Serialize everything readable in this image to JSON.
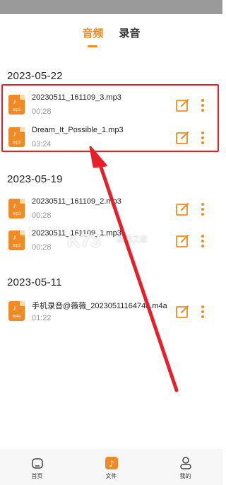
{
  "tabs": [
    {
      "label": "音频",
      "active": true
    },
    {
      "label": "录音",
      "active": false
    }
  ],
  "groups": [
    {
      "date": "2023-05-22",
      "items": [
        {
          "name": "20230511_161109_3.mp3",
          "duration": "00:28",
          "ext": "mp3"
        },
        {
          "name": "Dream_It_Possible_1.mp3",
          "duration": "03:24",
          "ext": "mp3"
        }
      ]
    },
    {
      "date": "2023-05-19",
      "items": [
        {
          "name": "20230511_161109_2.mp3",
          "duration": "00:28",
          "ext": "mp3"
        },
        {
          "name": "20230511_161109_1.mp3",
          "duration": "00:28",
          "ext": "mp3"
        }
      ]
    },
    {
      "date": "2023-05-11",
      "items": [
        {
          "name": "手机录音@薇薇_20230511164748.m4a",
          "duration": "01:22",
          "ext": "m4a"
        }
      ]
    }
  ],
  "watermark": {
    "logo": "K73",
    "sub": "游戏之家"
  },
  "bottom_nav": [
    {
      "label": "首页",
      "icon": "home-icon",
      "active": false
    },
    {
      "label": "文件",
      "icon": "music-file-icon",
      "active": true
    },
    {
      "label": "我的",
      "icon": "user-icon",
      "active": false
    }
  ],
  "colors": {
    "accent": "#f08a24",
    "highlight": "#e5202a",
    "status_bar": "#9a9a9a"
  }
}
